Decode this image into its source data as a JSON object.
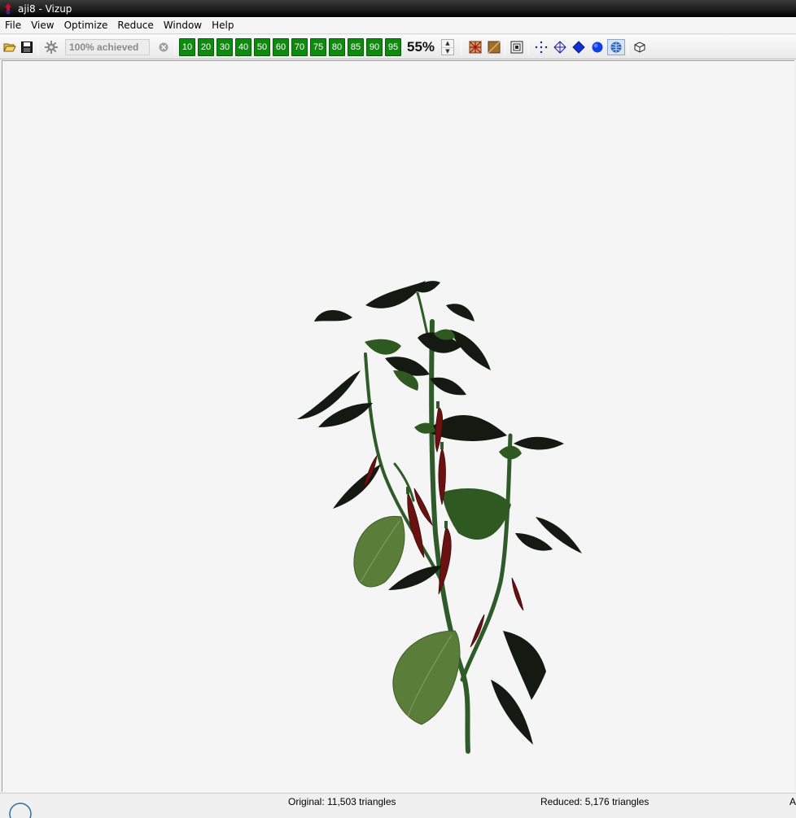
{
  "window": {
    "title": "aji8 - Vizup"
  },
  "menu": [
    "File",
    "View",
    "Optimize",
    "Reduce",
    "Window",
    "Help"
  ],
  "toolbar": {
    "status": "100% achieved",
    "presets": [
      "10",
      "20",
      "30",
      "40",
      "50",
      "60",
      "70",
      "75",
      "80",
      "85",
      "90",
      "95"
    ],
    "percent": "55%"
  },
  "icons": {
    "open": "folder-open-icon",
    "save": "save-icon",
    "reduce": "gear-icon",
    "stop": "stop-icon",
    "wireframe": "wireframe-grid-icon",
    "texture": "texture-icon",
    "window": "window-icon",
    "points": "points-icon",
    "edges": "edges-icon",
    "flat": "flat-shading-icon",
    "smooth": "smooth-shading-icon",
    "textured": "textured-sphere-icon",
    "box": "bounding-box-icon"
  },
  "colors": {
    "preset_bg": "#0e8a0e",
    "viewport_bg": "#f5f5f5"
  },
  "status": {
    "original": "Original: 11,503 triangles",
    "reduced": "Reduced: 5,176 triangles",
    "extra": "A"
  }
}
